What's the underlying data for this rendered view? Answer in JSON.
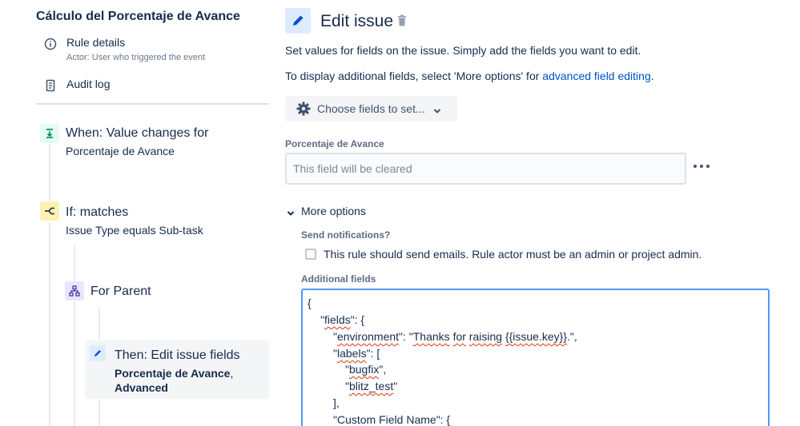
{
  "sidebar": {
    "rule_title": "Cálculo del Porcentaje de Avance",
    "rule_details": {
      "label": "Rule details",
      "sub": "Actor: User who triggered the event",
      "icon": "info-icon"
    },
    "audit_log": {
      "label": "Audit log",
      "icon": "document-icon"
    },
    "steps": [
      {
        "title": "When: Value changes for",
        "sub": "Porcentaje de Avance",
        "icon": "trigger-icon",
        "color": "#e3fcef"
      },
      {
        "title": "If: matches",
        "sub": "Issue Type equals Sub-task",
        "icon": "condition-icon",
        "color": "#fff0b3"
      },
      {
        "title": "For Parent",
        "icon": "branch-icon",
        "color": "#eae6ff"
      },
      {
        "title": "Then: Edit issue fields",
        "sub_bold": "Porcentaje de Avance",
        "sub_sep": ",",
        "sub_line2": "Advanced",
        "icon": "pencil-icon",
        "color": "#deebff"
      }
    ]
  },
  "main": {
    "title": "Edit issue",
    "desc1": "Set values for fields on the issue. Simply add the fields you want to edit.",
    "desc2_prefix": "To display additional fields, select 'More options' for ",
    "desc2_link": "advanced field editing",
    "desc2_suffix": ".",
    "choose_button": "Choose fields to set...",
    "field_label": "Porcentaje de Avance",
    "field_placeholder": "This field will be cleared",
    "more_options": "More options",
    "send_notifications_label": "Send notifications?",
    "send_emails_checkbox": "This rule should send emails. Rule actor must be an admin or project admin.",
    "additional_fields_label": "Additional fields",
    "code": {
      "l1": "{",
      "l2_q1": "\"",
      "l2_key": "fields",
      "l2_rest": "\": {",
      "l3_q1": "\"",
      "l3_key": "environment",
      "l3_mid": "\": \"",
      "l3_w1": "Thanks",
      "l3_sp1": " ",
      "l3_w2": "for",
      "l3_sp2": " ",
      "l3_w3": "raising",
      "l3_sp3": " ",
      "l3_w4": "{{issue.key}}",
      "l3_end": ".\",",
      "l4_q1": "\"",
      "l4_key": "labels",
      "l4_rest": "\": [",
      "l5_q1": "\"",
      "l5_key": "bugfix",
      "l5_rest": "\",",
      "l6_q1": "\"",
      "l6_key": "blitz_test",
      "l6_rest": "\"",
      "l7": "],",
      "l8_q1": "\"",
      "l8_key": "Custom",
      "l8_rest": " Field Name\": {"
    }
  },
  "colors": {
    "accent": "#0052cc",
    "focus": "#4c9aff",
    "text": "#172b4d"
  }
}
